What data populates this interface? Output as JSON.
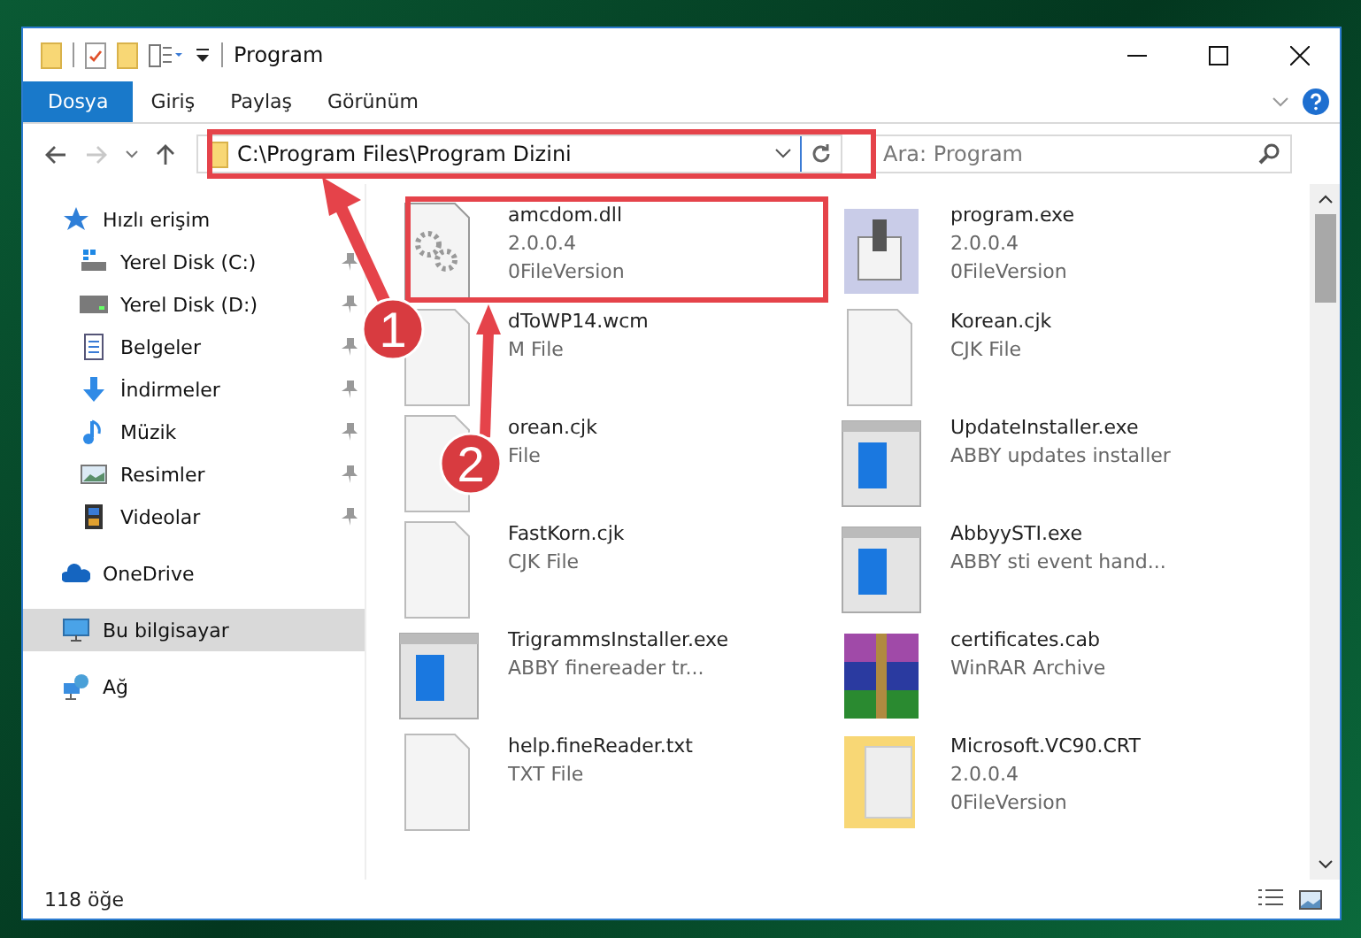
{
  "window": {
    "title": "Program"
  },
  "ribbon_tabs": [
    {
      "label": "Dosya",
      "selected": true
    },
    {
      "label": "Giriş",
      "selected": false
    },
    {
      "label": "Paylaş",
      "selected": false
    },
    {
      "label": "Görünüm",
      "selected": false
    }
  ],
  "address_bar": {
    "path": "C:\\Program Files\\Program Dizini"
  },
  "search": {
    "placeholder": "Ara: Program"
  },
  "sidebar": {
    "items": [
      {
        "label": "Hızlı erişim",
        "kind": "quick",
        "selected": false,
        "children": [
          {
            "label": "Yerel Disk (C:)",
            "kind": "disk-c",
            "pinned": true,
            "selected": false
          },
          {
            "label": "Yerel Disk (D:)",
            "kind": "disk",
            "pinned": true,
            "selected": false
          },
          {
            "label": "Belgeler",
            "kind": "docs",
            "pinned": true,
            "selected": false
          },
          {
            "label": "İndirmeler",
            "kind": "down",
            "pinned": true,
            "selected": false
          },
          {
            "label": "Müzik",
            "kind": "music",
            "pinned": true,
            "selected": false
          },
          {
            "label": "Resimler",
            "kind": "pics",
            "pinned": true,
            "selected": false
          },
          {
            "label": "Videolar",
            "kind": "video",
            "pinned": true,
            "selected": false
          }
        ]
      },
      {
        "label": "OneDrive",
        "kind": "cloud",
        "selected": false
      },
      {
        "label": "Bu bilgisayar",
        "kind": "pc",
        "selected": true
      },
      {
        "label": "Ağ",
        "kind": "net",
        "selected": false
      }
    ]
  },
  "files": [
    {
      "name": "amcdom.dll",
      "lines": [
        "2.0.0.4",
        "0FileVersion"
      ],
      "kind": "gears"
    },
    {
      "name": "program.exe",
      "lines": [
        "2.0.0.4",
        "0FileVersion"
      ],
      "kind": "app"
    },
    {
      "name": "dToWP14.wcm",
      "lines": [
        "M File"
      ],
      "kind": "doc"
    },
    {
      "name": "Korean.cjk",
      "lines": [
        "CJK File"
      ],
      "kind": "doc"
    },
    {
      "name": "orean.cjk",
      "lines": [
        "File"
      ],
      "kind": "doc"
    },
    {
      "name": "UpdateInstaller.exe",
      "lines": [
        "ABBY updates installer"
      ],
      "kind": "installer"
    },
    {
      "name": "FastKorn.cjk",
      "lines": [
        "CJK File"
      ],
      "kind": "doc"
    },
    {
      "name": "AbbyySTI.exe",
      "lines": [
        "ABBY sti event hand..."
      ],
      "kind": "installer"
    },
    {
      "name": "TrigrammsInstaller.exe",
      "lines": [
        "ABBY finereader tr..."
      ],
      "kind": "installer"
    },
    {
      "name": "certificates.cab",
      "lines": [
        "WinRAR Archive"
      ],
      "kind": "archive"
    },
    {
      "name": "help.fineReader.txt",
      "lines": [
        "TXT File"
      ],
      "kind": "doc"
    },
    {
      "name": "Microsoft.VC90.CRT",
      "lines": [
        "2.0.0.4",
        "0FileVersion"
      ],
      "kind": "folder"
    }
  ],
  "status_bar": {
    "count": "118 öğe"
  },
  "annotations": [
    {
      "label": "1"
    },
    {
      "label": "2"
    }
  ]
}
